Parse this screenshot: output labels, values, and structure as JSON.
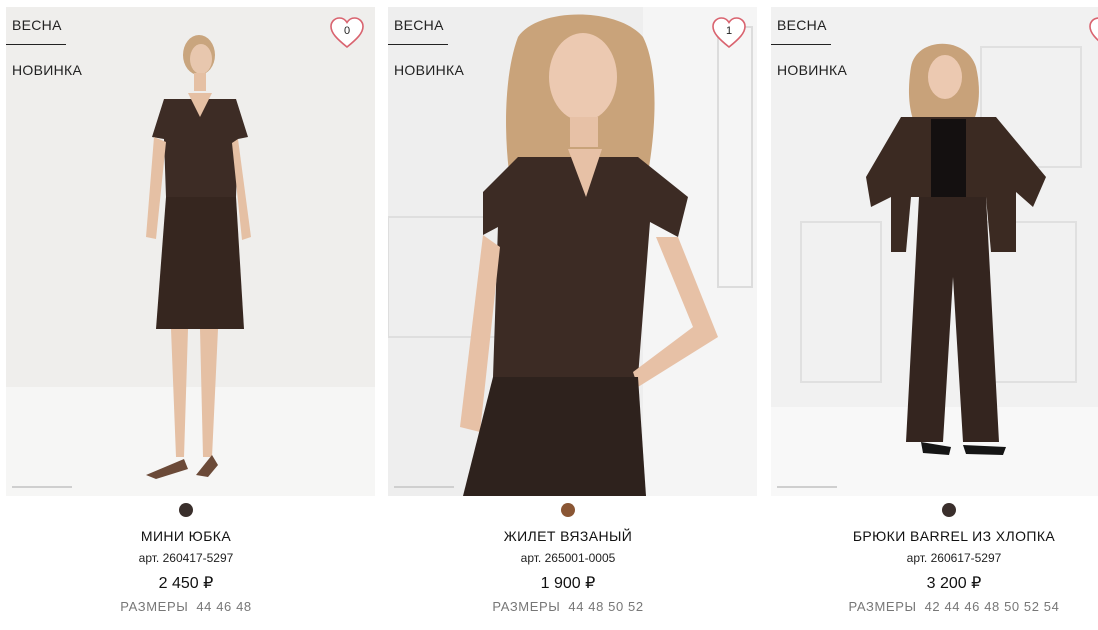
{
  "products": [
    {
      "badges": [
        "ВЕСНА",
        "НОВИНКА"
      ],
      "favorites_count": "0",
      "color_hex": "#3a2f2c",
      "name": "МИНИ ЮБКА",
      "article": "арт. 260417-5297",
      "price": "2 450 ₽",
      "sizes_label": "РАЗМЕРЫ",
      "sizes": "44 46 48"
    },
    {
      "badges": [
        "ВЕСНА",
        "НОВИНКА"
      ],
      "favorites_count": "1",
      "color_hex": "#8a5634",
      "name": "ЖИЛЕТ ВЯЗАНЫЙ",
      "article": "арт. 265001-0005",
      "price": "1 900 ₽",
      "sizes_label": "РАЗМЕРЫ",
      "sizes": "44 48 50 52"
    },
    {
      "badges": [
        "ВЕСНА",
        "НОВИНКА"
      ],
      "favorites_count": "",
      "color_hex": "#3a2f2c",
      "name": "БРЮКИ BARREL ИЗ ХЛОПКА",
      "article": "арт. 260617-5297",
      "price": "3 200 ₽",
      "sizes_label": "РАЗМЕРЫ",
      "sizes": "42 44 46 48 50 52 54"
    }
  ],
  "colors": {
    "garment": "#3b2b24",
    "background": "#f0efed",
    "heart": "#d9636f"
  }
}
